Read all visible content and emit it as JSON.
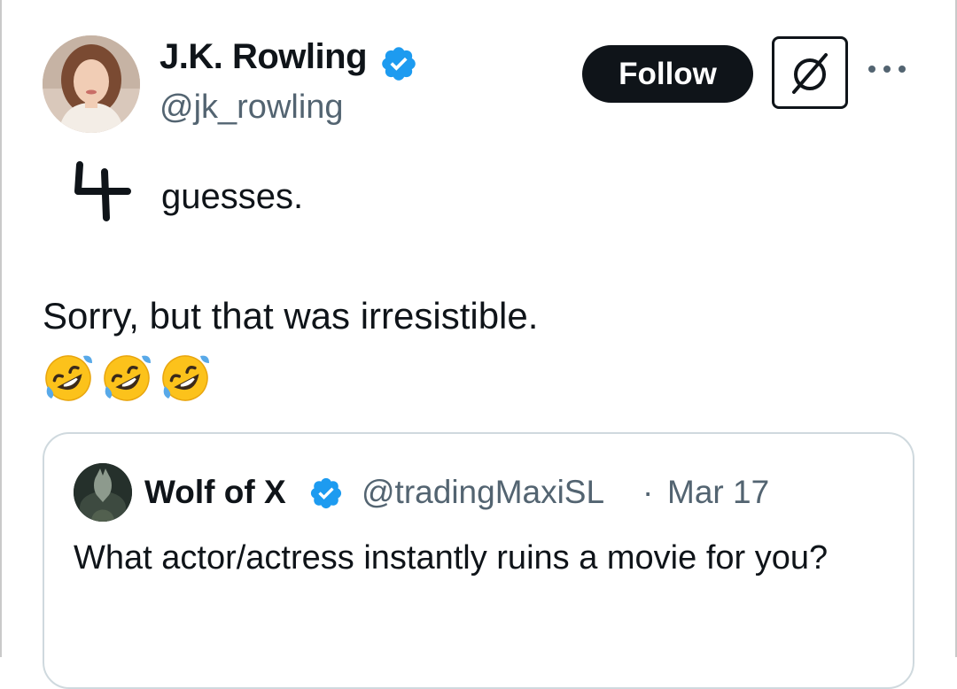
{
  "tweet": {
    "author": {
      "name": "J.K. Rowling",
      "handle": "@jk_rowling",
      "verified": true
    },
    "actions": {
      "follow_label": "Follow",
      "grok_icon": "slashed-circle-icon",
      "more_icon": "more-dots-icon"
    },
    "body": {
      "handwritten_digit": "4",
      "line1_text": "guesses.",
      "line2_text": "Sorry, but that was irresistible.",
      "emoji": [
        "🤣",
        "🤣",
        "🤣"
      ]
    },
    "quote": {
      "name": "Wolf of X",
      "handle": "@tradingMaxiSL",
      "separator": "·",
      "date": "Mar 17",
      "text": "What actor/actress instantly ruins a movie for you?",
      "verified": true
    }
  },
  "colors": {
    "text_primary": "#0f1419",
    "text_secondary": "#536471",
    "verified_blue": "#1d9bf0",
    "follow_bg": "#0f1419",
    "border": "#cfd9de"
  }
}
